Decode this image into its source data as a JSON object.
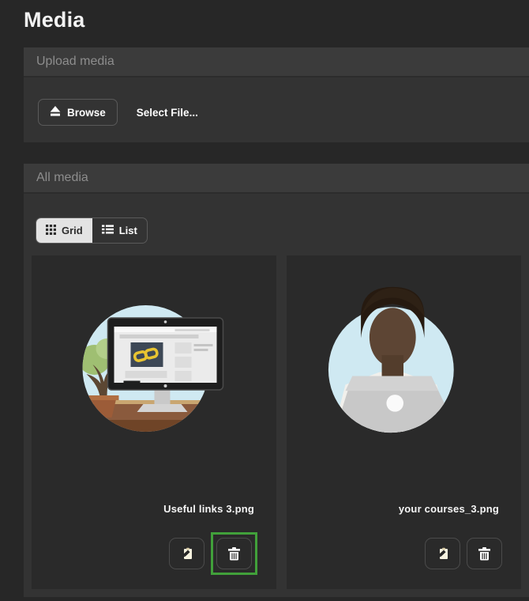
{
  "page": {
    "title": "Media"
  },
  "upload_panel": {
    "title": "Upload media",
    "browse_button": "Browse",
    "file_label": "Select File..."
  },
  "media_panel": {
    "title": "All media",
    "view_toggle": {
      "grid": "Grid",
      "list": "List",
      "active": "Grid"
    },
    "items": [
      {
        "filename": "Useful links 3.png",
        "thumbnail": "monitor-with-link-illustration",
        "delete_highlighted": true
      },
      {
        "filename": "your courses_3.png",
        "thumbnail": "person-with-laptop-illustration",
        "delete_highlighted": false
      }
    ]
  },
  "icons": {
    "browse": "upload-icon",
    "grid": "grid-icon",
    "list": "list-icon",
    "copy": "clipboard-icon",
    "delete": "trash-icon"
  },
  "colors": {
    "page_background": "#272727",
    "panel_header": "#3b3b3b",
    "panel_body": "#333333",
    "card_background": "#2a2a2a",
    "highlight_green": "#41a03a",
    "link_yellow": "#e8c431",
    "thumbnail_blue": "#cfe9f2"
  }
}
